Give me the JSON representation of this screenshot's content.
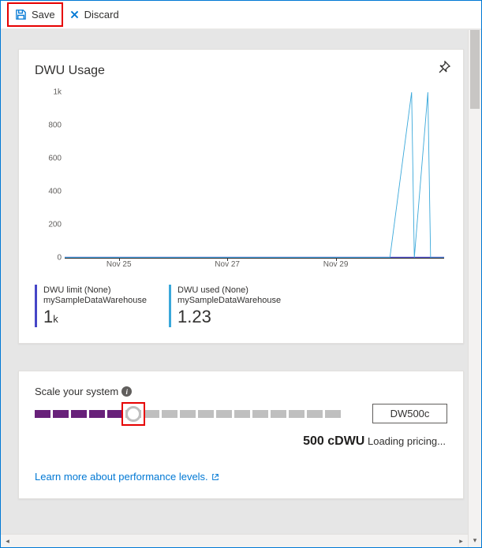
{
  "toolbar": {
    "save_label": "Save",
    "discard_label": "Discard"
  },
  "colors": {
    "limit": "#4646c7",
    "used": "#3aa8da"
  },
  "chart": {
    "title": "DWU Usage",
    "y_ticks": [
      "1k",
      "800",
      "600",
      "400",
      "200",
      "0"
    ],
    "y_max": 1000,
    "x_ticks": [
      "Nov 25",
      "Nov 27",
      "Nov 29"
    ],
    "legend": [
      {
        "label": "DWU limit (None)",
        "sub": "mySampleDataWarehouse",
        "value": "1",
        "unit": "k"
      },
      {
        "label": "DWU used (None)",
        "sub": "mySampleDataWarehouse",
        "value": "1.23",
        "unit": ""
      }
    ]
  },
  "chart_data": {
    "type": "line",
    "title": "DWU Usage",
    "xlabel": "",
    "ylabel": "",
    "ylim": [
      0,
      1000
    ],
    "x": [
      0,
      1,
      2,
      3,
      4,
      5,
      6,
      6.4,
      6.45,
      6.7,
      6.75,
      7
    ],
    "x_tick_labels": {
      "1": "Nov 25",
      "3": "Nov 27",
      "5": "Nov 29"
    },
    "series": [
      {
        "name": "DWU limit (None) — mySampleDataWarehouse",
        "values": [
          2,
          2,
          2,
          2,
          2,
          2,
          2,
          2,
          2,
          2,
          2,
          2
        ]
      },
      {
        "name": "DWU used (None) — mySampleDataWarehouse",
        "values": [
          2,
          2,
          2,
          2,
          2,
          2,
          2,
          1000,
          0,
          1000,
          0,
          0
        ]
      }
    ]
  },
  "scale": {
    "section_label": "Scale your system",
    "total_segments": 17,
    "filled_segments": 5,
    "thumb_index": 5,
    "tier_value": "DW500c",
    "summary_value": "500 cDWU",
    "summary_suffix": "Loading pricing...",
    "learn_link": "Learn more about performance levels."
  }
}
